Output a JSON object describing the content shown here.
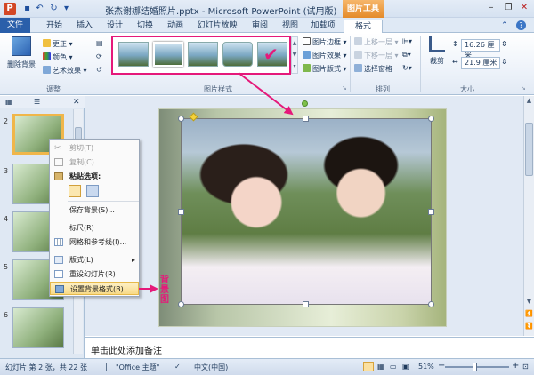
{
  "titlebar": {
    "app_logo": "P",
    "title": "张杰谢娜结婚照片.pptx - Microsoft PowerPoint (试用版)",
    "context_tab_header": "图片工具",
    "quick_access": [
      "save-icon",
      "undo-icon",
      "redo-icon",
      "customize-icon"
    ]
  },
  "tabs": {
    "file": "文件",
    "items": [
      "开始",
      "插入",
      "设计",
      "切换",
      "动画",
      "幻灯片放映",
      "审阅",
      "视图",
      "加载项"
    ],
    "format": "格式"
  },
  "ribbon": {
    "adjust": {
      "remove_bg": "删除背景",
      "corrections": "更正",
      "color": "颜色",
      "artistic": "艺术效果",
      "label": "调整"
    },
    "picture_styles": {
      "label": "图片样式",
      "border": "图片边框",
      "effects": "图片效果",
      "layout": "图片版式"
    },
    "arrange": {
      "label": "排列",
      "bring_forward": "上移一层",
      "send_backward": "下移一层",
      "selection_pane": "选择窗格"
    },
    "size": {
      "label": "大小",
      "crop": "裁剪",
      "height": "16.26 厘米",
      "width": "21.9 厘米"
    }
  },
  "thumb_pane": {
    "slide_numbers": [
      "2",
      "3",
      "4",
      "5",
      "6"
    ]
  },
  "slide": {
    "bg_label": "背景图"
  },
  "context_menu": {
    "cut": "剪切(T)",
    "copy": "复制(C)",
    "paste_options": "粘贴选项:",
    "save_background": "保存背景(S)...",
    "ruler": "标尺(R)",
    "grid_guides": "网格和参考线(I)...",
    "layout": "版式(L)",
    "reset_slide": "重设幻灯片(R)",
    "format_background": "设置背景格式(B)..."
  },
  "notes": {
    "placeholder": "单击此处添加备注"
  },
  "statusbar": {
    "slide_info": "幻灯片 第 2 张，共 22 张",
    "theme": "\"Office 主题\"",
    "language": "中文(中国)",
    "zoom": "51%"
  },
  "colors": {
    "accent_pink": "#e5197a",
    "file_tab": "#2a5faa",
    "context_orange": "#e48a2a"
  }
}
